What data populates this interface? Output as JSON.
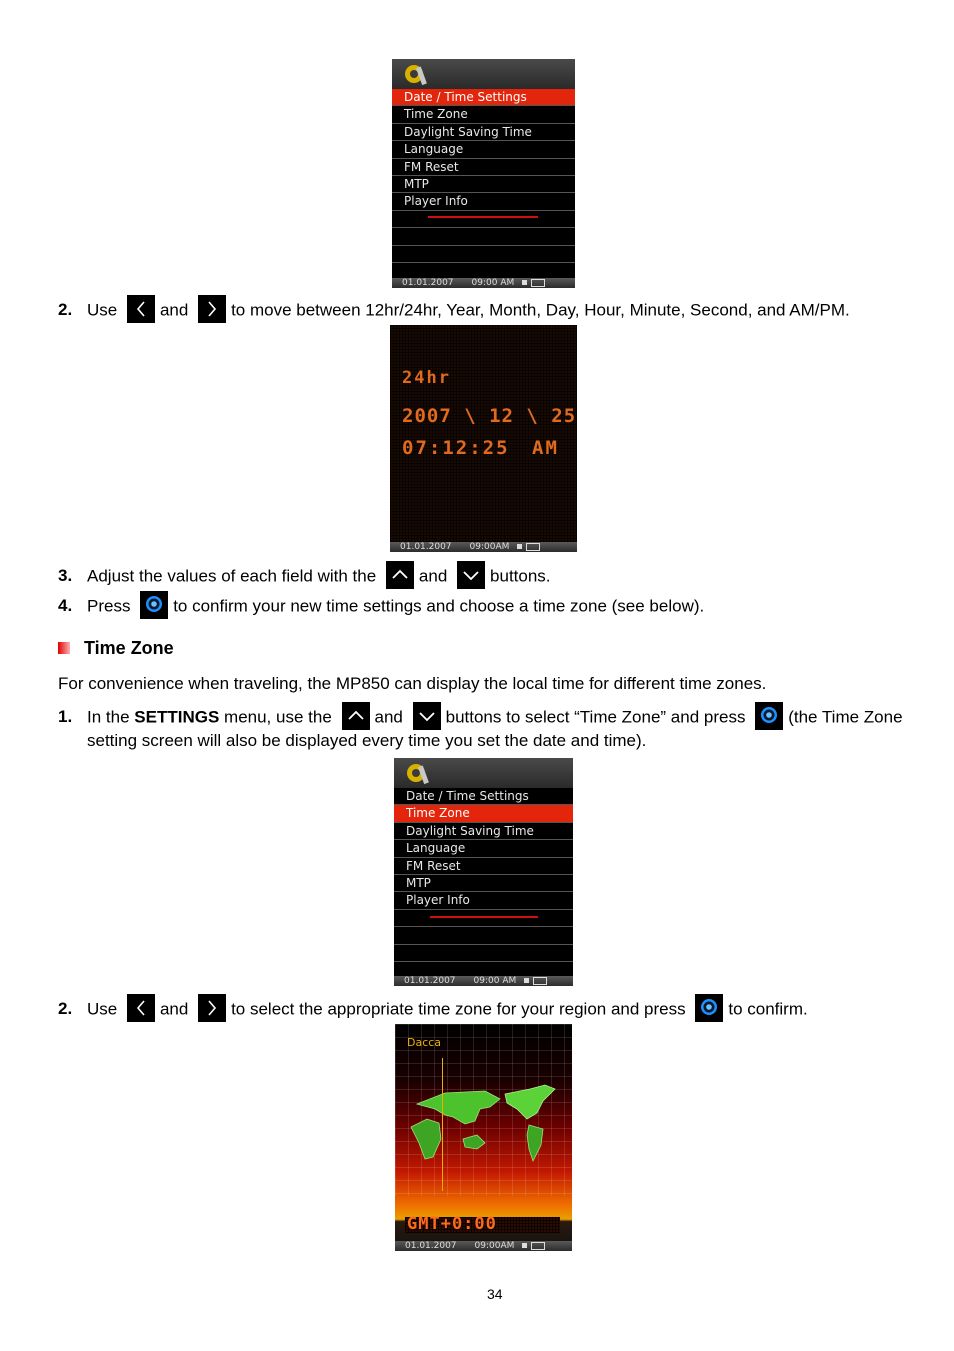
{
  "settings_menu": {
    "icon": "gear-wrench-icon",
    "items": [
      "Date / Time Settings",
      "Time Zone",
      "Daylight Saving Time",
      "Language",
      "FM Reset",
      "MTP",
      "Player Info"
    ],
    "status_date": "01.01.2007",
    "status_time": "09:00 AM"
  },
  "steps_a": {
    "step2": {
      "num": "2.",
      "pre": "Use",
      "and": "and",
      "post": "to move between 12hr/24hr, Year, Month, Day, Hour, Minute, Second, and AM/PM."
    },
    "step3": {
      "num": "3.",
      "pre": "Adjust the values of each field with the",
      "and": "and",
      "post": "buttons."
    },
    "step4": {
      "num": "4.",
      "pre": "Press",
      "post": "to confirm your new time settings and choose a time zone (see below)."
    }
  },
  "clock_screen": {
    "mode": "24hr",
    "date": "2007 \\ 12 \\ 25",
    "time": "07:12:25",
    "ampm": "AM",
    "status_date": "01.01.2007",
    "status_time": "09:00AM"
  },
  "section": {
    "title": "Time Zone",
    "intro": "For convenience when traveling, the MP850 can display the local time for different time zones."
  },
  "steps_b": {
    "step1": {
      "num": "1.",
      "pre": "In the",
      "bold": "SETTINGS",
      "mid": "menu, use the",
      "and": "and",
      "post": "buttons to select “Time Zone” and press",
      "tail": "(the Time Zone",
      "line2": "setting screen will also be displayed every time you set the date and time)."
    },
    "step2": {
      "num": "2.",
      "pre": "Use",
      "and": "and",
      "mid": "to select the appropriate time zone for your region and press",
      "post": "to confirm."
    }
  },
  "timezone_screen": {
    "city": "Dacca",
    "offset": "GMT+0:00",
    "status_date": "01.01.2007",
    "status_time": "09:00AM"
  },
  "page_number": "34"
}
